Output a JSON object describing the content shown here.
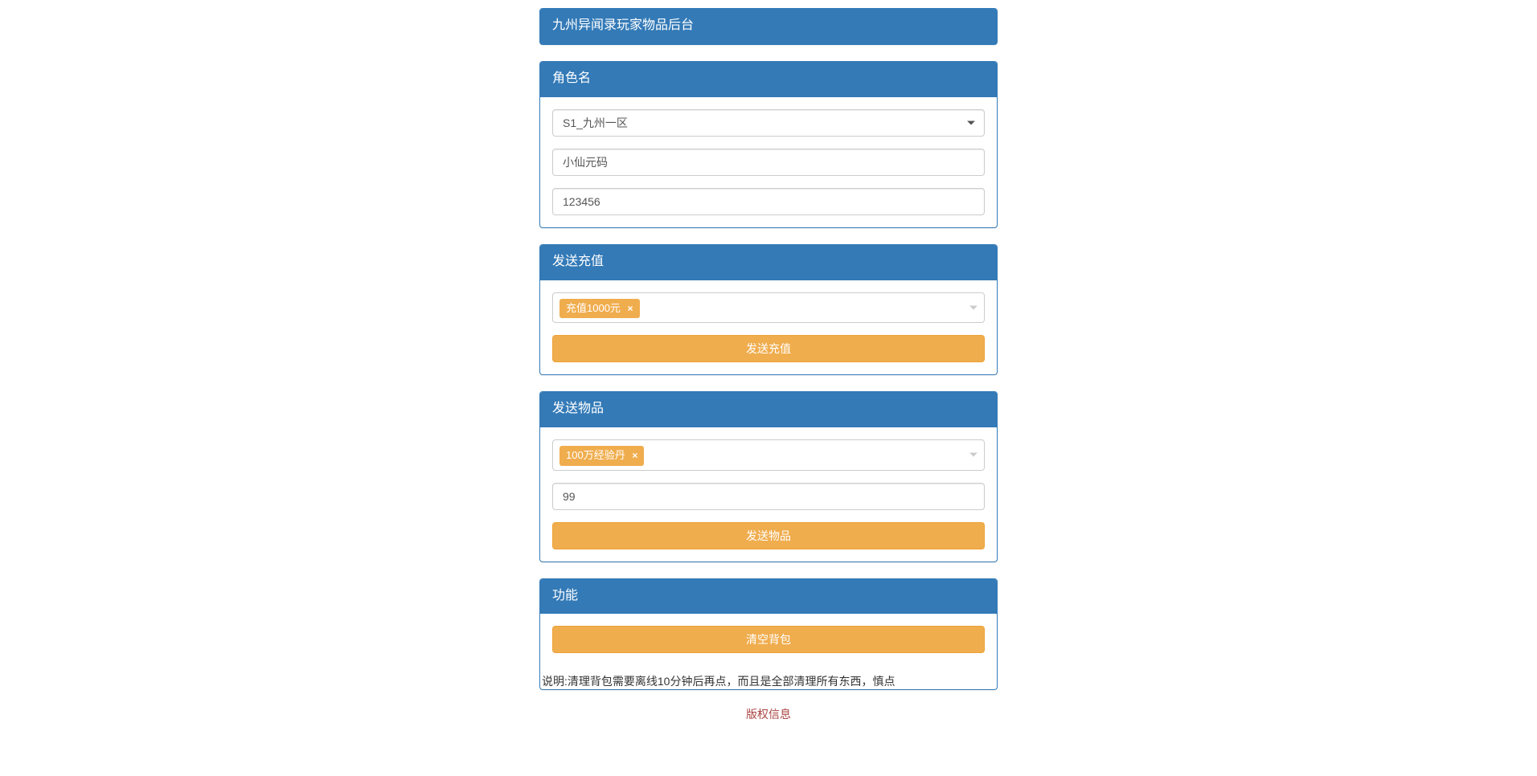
{
  "header": {
    "title": "九州异闻录玩家物品后台"
  },
  "character_panel": {
    "title": "角色名",
    "server_selected": "S1_九州一区",
    "name_value": "小仙元码",
    "id_value": "123456"
  },
  "recharge_panel": {
    "title": "发送充值",
    "selected_tag": "充值1000元",
    "button_label": "发送充值"
  },
  "item_panel": {
    "title": "发送物品",
    "selected_tag": "100万经验丹",
    "quantity_value": "99",
    "button_label": "发送物品"
  },
  "function_panel": {
    "title": "功能",
    "clear_button_label": "清空背包",
    "note_text": "说明:清理背包需要离线10分钟后再点，而且是全部清理所有东西，慎点"
  },
  "footer": {
    "text": "版权信息"
  }
}
